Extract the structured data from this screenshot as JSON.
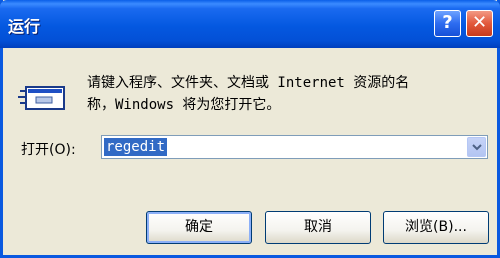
{
  "window": {
    "title": "运行",
    "help_icon": "?",
    "close_icon": "✕"
  },
  "description": {
    "line1": "请键入程序、文件夹、文档或 Internet 资源的名",
    "line2": "称，Windows 将为您打开它。"
  },
  "open_field": {
    "label": "打开(O):",
    "value": "regedit"
  },
  "buttons": {
    "ok": "确定",
    "cancel": "取消",
    "browse": "浏览(B)..."
  },
  "colors": {
    "titlebar": "#0458e0",
    "dialog_bg": "#ece9d8",
    "selection": "#316ac5"
  }
}
